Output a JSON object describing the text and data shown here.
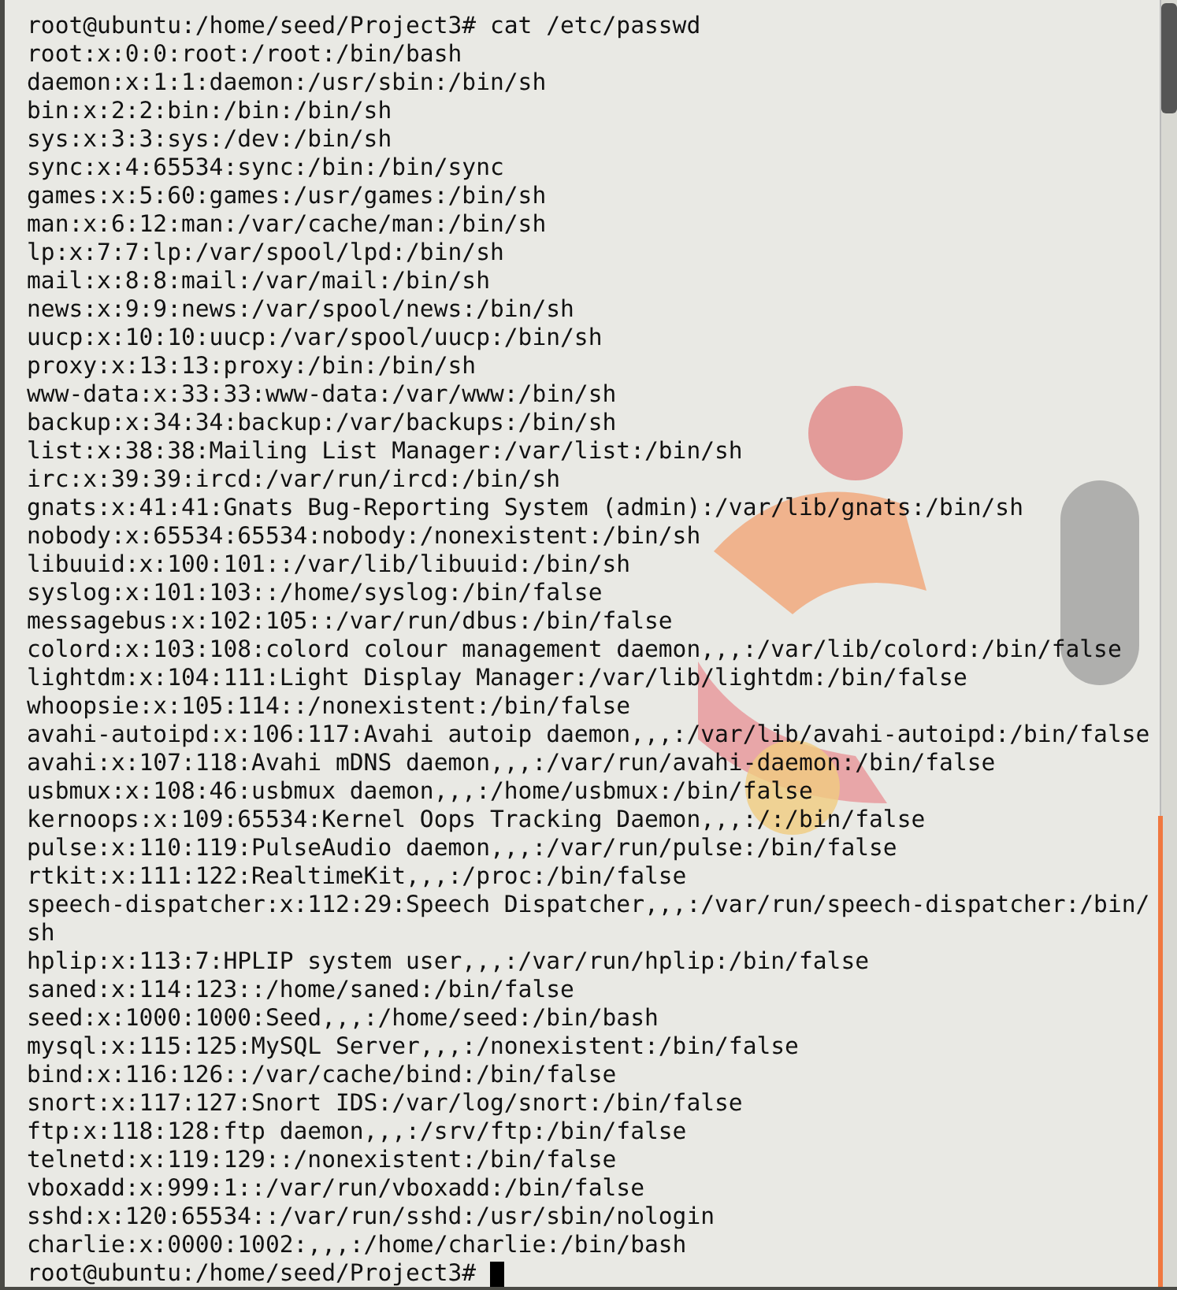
{
  "terminal": {
    "lines": [
      "root@ubuntu:/home/seed/Project3# cat /etc/passwd",
      "root:x:0:0:root:/root:/bin/bash",
      "daemon:x:1:1:daemon:/usr/sbin:/bin/sh",
      "bin:x:2:2:bin:/bin:/bin/sh",
      "sys:x:3:3:sys:/dev:/bin/sh",
      "sync:x:4:65534:sync:/bin:/bin/sync",
      "games:x:5:60:games:/usr/games:/bin/sh",
      "man:x:6:12:man:/var/cache/man:/bin/sh",
      "lp:x:7:7:lp:/var/spool/lpd:/bin/sh",
      "mail:x:8:8:mail:/var/mail:/bin/sh",
      "news:x:9:9:news:/var/spool/news:/bin/sh",
      "uucp:x:10:10:uucp:/var/spool/uucp:/bin/sh",
      "proxy:x:13:13:proxy:/bin:/bin/sh",
      "www-data:x:33:33:www-data:/var/www:/bin/sh",
      "backup:x:34:34:backup:/var/backups:/bin/sh",
      "list:x:38:38:Mailing List Manager:/var/list:/bin/sh",
      "irc:x:39:39:ircd:/var/run/ircd:/bin/sh",
      "gnats:x:41:41:Gnats Bug-Reporting System (admin):/var/lib/gnats:/bin/sh",
      "nobody:x:65534:65534:nobody:/nonexistent:/bin/sh",
      "libuuid:x:100:101::/var/lib/libuuid:/bin/sh",
      "syslog:x:101:103::/home/syslog:/bin/false",
      "messagebus:x:102:105::/var/run/dbus:/bin/false",
      "colord:x:103:108:colord colour management daemon,,,:/var/lib/colord:/bin/false",
      "lightdm:x:104:111:Light Display Manager:/var/lib/lightdm:/bin/false",
      "whoopsie:x:105:114::/nonexistent:/bin/false",
      "avahi-autoipd:x:106:117:Avahi autoip daemon,,,:/var/lib/avahi-autoipd:/bin/false",
      "avahi:x:107:118:Avahi mDNS daemon,,,:/var/run/avahi-daemon:/bin/false",
      "usbmux:x:108:46:usbmux daemon,,,:/home/usbmux:/bin/false",
      "kernoops:x:109:65534:Kernel Oops Tracking Daemon,,,:/:/bin/false",
      "pulse:x:110:119:PulseAudio daemon,,,:/var/run/pulse:/bin/false",
      "rtkit:x:111:122:RealtimeKit,,,:/proc:/bin/false",
      "speech-dispatcher:x:112:29:Speech Dispatcher,,,:/var/run/speech-dispatcher:/bin/",
      "sh",
      "hplip:x:113:7:HPLIP system user,,,:/var/run/hplip:/bin/false",
      "saned:x:114:123::/home/saned:/bin/false",
      "seed:x:1000:1000:Seed,,,:/home/seed:/bin/bash",
      "mysql:x:115:125:MySQL Server,,,:/nonexistent:/bin/false",
      "bind:x:116:126::/var/cache/bind:/bin/false",
      "snort:x:117:127:Snort IDS:/var/log/snort:/bin/false",
      "ftp:x:118:128:ftp daemon,,,:/srv/ftp:/bin/false",
      "telnetd:x:119:129::/nonexistent:/bin/false",
      "vboxadd:x:999:1::/var/run/vboxadd:/bin/false",
      "sshd:x:120:65534::/var/run/sshd:/usr/sbin/nologin",
      "charlie:x:0000:1002:,,,:/home/charlie:/bin/bash"
    ],
    "prompt": "root@ubuntu:/home/seed/Project3#"
  }
}
